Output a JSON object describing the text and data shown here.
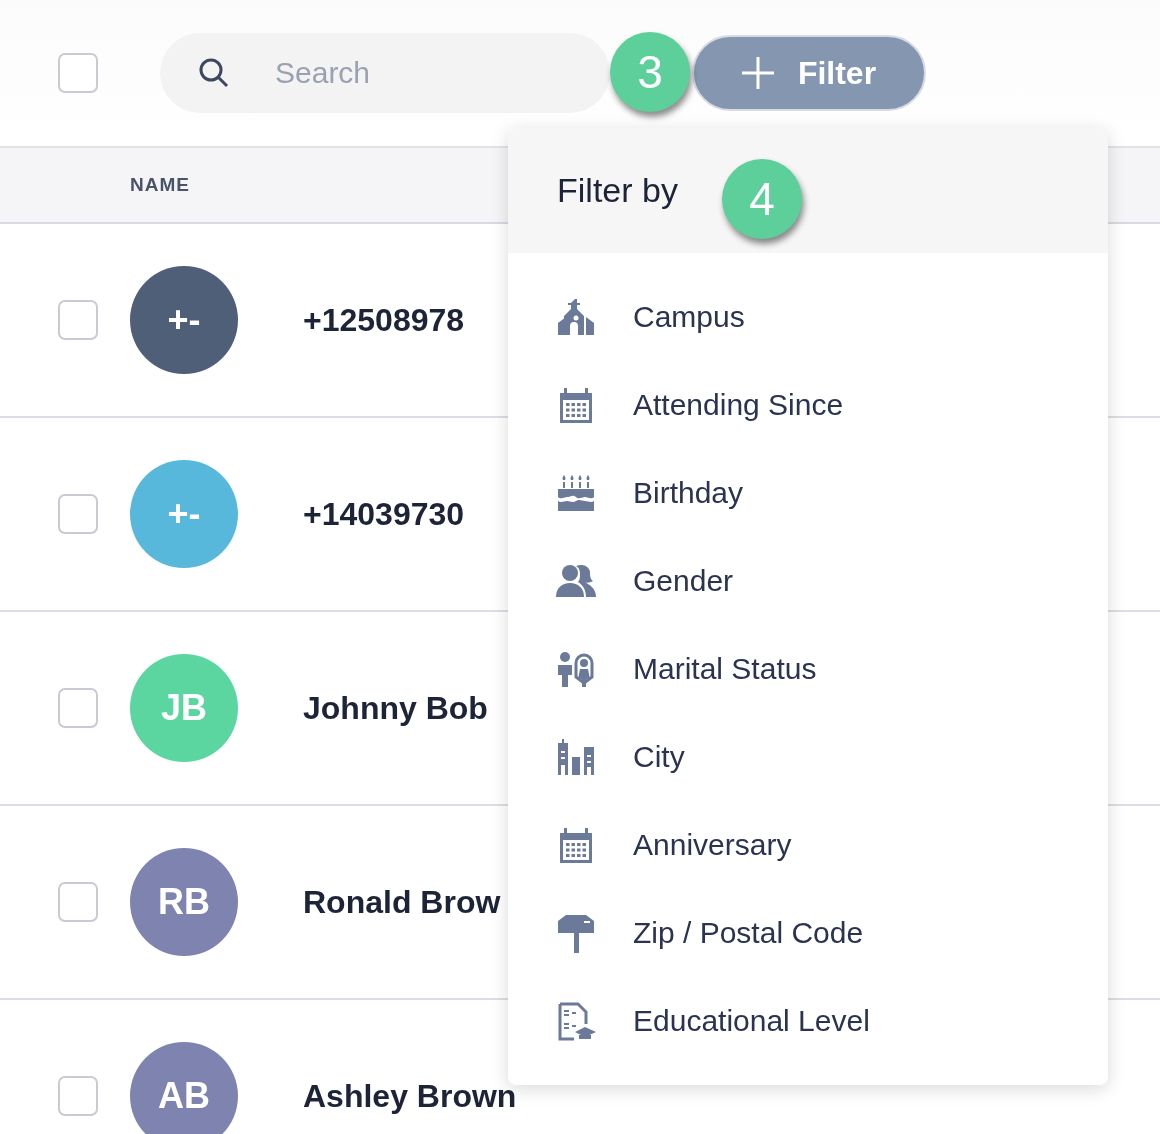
{
  "toolbar": {
    "select_all": {
      "checked": false
    },
    "search": {
      "placeholder": "Search"
    },
    "filter_button": "Filter",
    "step_badge": "3"
  },
  "table": {
    "columns": [
      "NAME"
    ],
    "rows": [
      {
        "checked": false,
        "initials": "+-",
        "color": "#4f5f78",
        "name": "+12508978"
      },
      {
        "checked": false,
        "initials": "+-",
        "color": "#58b8dc",
        "name": "+14039730"
      },
      {
        "checked": false,
        "initials": "JB",
        "color": "#5cd6a0",
        "name": "Johnny Bob"
      },
      {
        "checked": false,
        "initials": "RB",
        "color": "#7e83b0",
        "name": "Ronald Brow"
      },
      {
        "checked": false,
        "initials": "AB",
        "color": "#7e83b0",
        "name": "Ashley Brown"
      }
    ]
  },
  "filter_menu": {
    "title": "Filter by",
    "step_badge": "4",
    "items": [
      {
        "kind": "church",
        "label": "Campus"
      },
      {
        "kind": "calendar",
        "label": "Attending Since"
      },
      {
        "kind": "cake",
        "label": "Birthday"
      },
      {
        "kind": "people",
        "label": "Gender"
      },
      {
        "kind": "couple",
        "label": "Marital Status"
      },
      {
        "kind": "buildings",
        "label": "City"
      },
      {
        "kind": "calendar",
        "label": "Anniversary"
      },
      {
        "kind": "mailbox",
        "label": "Zip / Postal Code"
      },
      {
        "kind": "education",
        "label": "Educational Level"
      }
    ]
  }
}
